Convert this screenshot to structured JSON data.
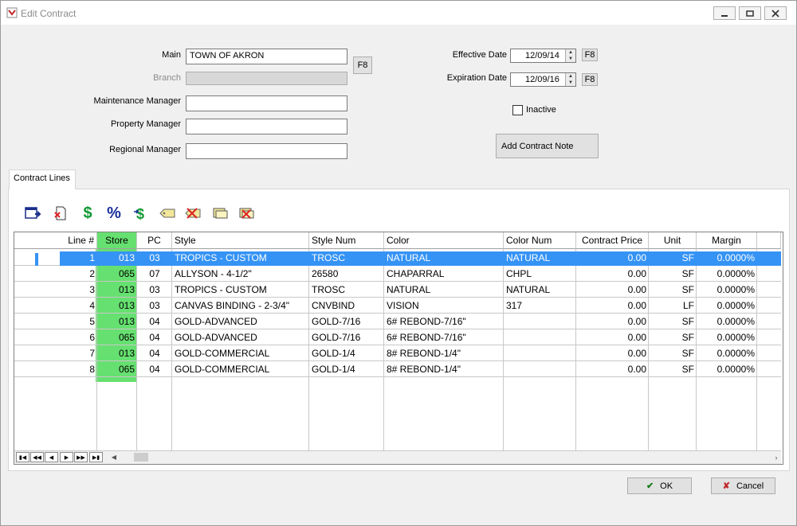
{
  "window": {
    "title": "Edit Contract"
  },
  "form": {
    "main_label": "Main",
    "main_value": "TOWN OF AKRON",
    "f8_label": "F8",
    "branch_label": "Branch",
    "maintenance_manager_label": "Maintenance Manager",
    "property_manager_label": "Property Manager",
    "regional_manager_label": "Regional Manager",
    "effective_date_label": "Effective Date",
    "effective_date_value": "12/09/14",
    "expiration_date_label": "Expiration Date",
    "expiration_date_value": "12/09/16",
    "inactive_label": "Inactive",
    "add_note_label": "Add Contract Note"
  },
  "tabs": [
    {
      "label": "Contract Lines"
    }
  ],
  "toolbar_icons": [
    "window-arrow-icon",
    "delete-doc-icon",
    "dollar-icon",
    "percent-icon",
    "dollar-arrow-icon",
    "tag-icon",
    "tag-delete-icon",
    "note-icon",
    "note-delete-icon"
  ],
  "grid": {
    "columns": [
      "Line #",
      "Store",
      "PC",
      "Style",
      "Style Num",
      "Color",
      "Color Num",
      "Contract Price",
      "Unit",
      "Margin"
    ],
    "rows": [
      [
        "1",
        "013",
        "03",
        "TROPICS - CUSTOM",
        "TROSC",
        "NATURAL",
        "NATURAL",
        "0.00",
        "SF",
        "0.0000%"
      ],
      [
        "2",
        "065",
        "07",
        "ALLYSON - 4-1/2\"",
        "26580",
        "CHAPARRAL",
        "CHPL",
        "0.00",
        "SF",
        "0.0000%"
      ],
      [
        "3",
        "013",
        "03",
        "TROPICS - CUSTOM",
        "TROSC",
        "NATURAL",
        "NATURAL",
        "0.00",
        "SF",
        "0.0000%"
      ],
      [
        "4",
        "013",
        "03",
        "CANVAS BINDING - 2-3/4\"",
        "CNVBIND",
        "VISION",
        "317",
        "0.00",
        "LF",
        "0.0000%"
      ],
      [
        "5",
        "013",
        "04",
        "GOLD-ADVANCED",
        "GOLD-7/16",
        "6# REBOND-7/16\"",
        "",
        "0.00",
        "SF",
        "0.0000%"
      ],
      [
        "6",
        "065",
        "04",
        "GOLD-ADVANCED",
        "GOLD-7/16",
        "6# REBOND-7/16\"",
        "",
        "0.00",
        "SF",
        "0.0000%"
      ],
      [
        "7",
        "013",
        "04",
        "GOLD-COMMERCIAL",
        "GOLD-1/4",
        "8# REBOND-1/4\"",
        "",
        "0.00",
        "SF",
        "0.0000%"
      ],
      [
        "8",
        "065",
        "04",
        "GOLD-COMMERCIAL",
        "GOLD-1/4",
        "8# REBOND-1/4\"",
        "",
        "0.00",
        "SF",
        "0.0000%"
      ]
    ],
    "selected_row": 0,
    "highlight_color": "#66e070",
    "selection_color": "#3593f5"
  },
  "buttons": {
    "ok_label": "OK",
    "cancel_label": "Cancel"
  }
}
